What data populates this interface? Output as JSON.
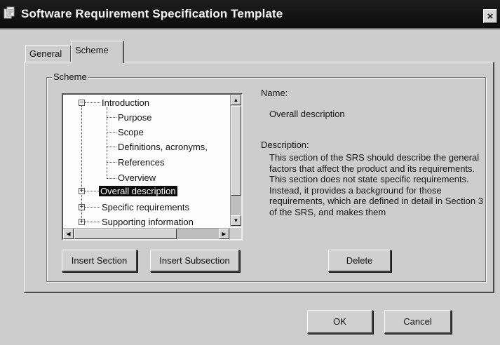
{
  "window": {
    "title": "Software Requirement Specification Template",
    "close_glyph": "×"
  },
  "tabs": [
    {
      "label": "General",
      "active": false
    },
    {
      "label": "Scheme",
      "active": true
    }
  ],
  "scheme_group": {
    "label": "Scheme"
  },
  "tree": {
    "items": [
      {
        "label": "Introduction",
        "level": 0,
        "expander": "−"
      },
      {
        "label": "Purpose",
        "level": 1
      },
      {
        "label": "Scope",
        "level": 1
      },
      {
        "label": "Definitions, acronyms,",
        "level": 1
      },
      {
        "label": "References",
        "level": 1
      },
      {
        "label": "Overview",
        "level": 1
      },
      {
        "label": "Overall description",
        "level": 0,
        "expander": "+",
        "selected": true
      },
      {
        "label": "Specific requirements",
        "level": 0,
        "expander": "+"
      },
      {
        "label": "Supporting information",
        "level": 0,
        "expander": "+"
      }
    ],
    "scroll_up": "▲",
    "scroll_down": "▼",
    "scroll_left": "◀",
    "scroll_right": "▶"
  },
  "details": {
    "name_label": "Name:",
    "name_value": "Overall description",
    "description_label": "Description:",
    "description_value": "This section of the SRS should describe the general factors that affect the product and its requirements. This section does not state specific requirements. Instead, it provides a background for those requirements, which are defined in detail in Section 3 of the SRS, and makes them"
  },
  "buttons": {
    "insert_section": "Insert Section",
    "insert_subsection": "Insert Subsection",
    "delete": "Delete",
    "ok": "OK",
    "cancel": "Cancel"
  },
  "colors": {
    "titlebar": "#111111",
    "window_bg": "#cdcdcd",
    "selection": "#0a0a0a"
  }
}
